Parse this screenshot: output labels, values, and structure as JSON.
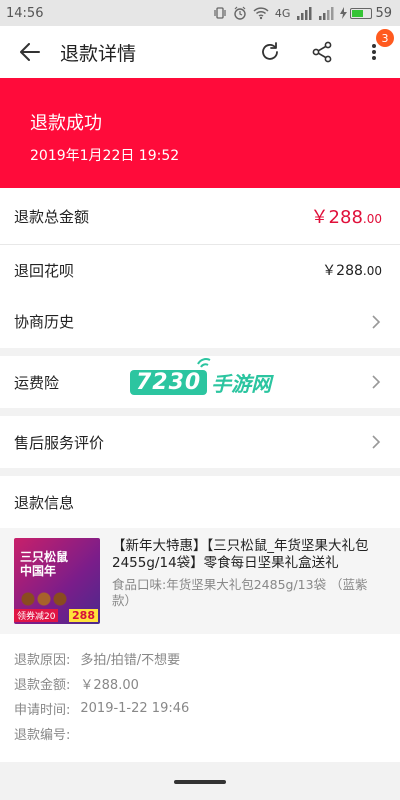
{
  "status_bar": {
    "time": "14:56",
    "battery_level": "59",
    "network_label": "4G"
  },
  "header": {
    "title": "退款详情",
    "badge_count": "3"
  },
  "banner": {
    "status": "退款成功",
    "time": "2019年1月22日 19:52"
  },
  "summary": {
    "total_label": "退款总金额",
    "total_amount_main": "￥288",
    "total_amount_decimal": ".00",
    "refund_to_label": "退回花呗",
    "refund_to_amount_main": "￥288",
    "refund_to_amount_decimal": ".00",
    "negotiation_label": "协商历史"
  },
  "shipping_insurance": {
    "label": "运费险"
  },
  "after_sales": {
    "label": "售后服务评价"
  },
  "refund_info": {
    "title": "退款信息"
  },
  "watermark": {
    "number": "7230",
    "text": "手游网"
  },
  "product": {
    "name": "【新年大特惠】【三只松鼠_年货坚果大礼包2455g/14袋】零食每日坚果礼盒送礼",
    "spec": "食品口味:年货坚果大礼包2485g/13袋 （蓝紫款）",
    "thumb_box_text": "三只松鼠 中国年",
    "thumb_promo": "领券减20",
    "thumb_price": "288"
  },
  "details": {
    "reason_label": "退款原因:",
    "reason_value": "多拍/拍错/不想要",
    "amount_label": "退款金额:",
    "amount_value": "￥288.00",
    "apply_time_label": "申请时间:",
    "apply_time_value": "2019-1-22 19:46",
    "refund_no_label": "退款编号:",
    "refund_no_value": ""
  },
  "colors": {
    "accent_red": "#ff0b3a",
    "price_red": "#e0103a",
    "badge_orange": "#ff5a1f",
    "watermark_green": "#2cc5a0"
  }
}
